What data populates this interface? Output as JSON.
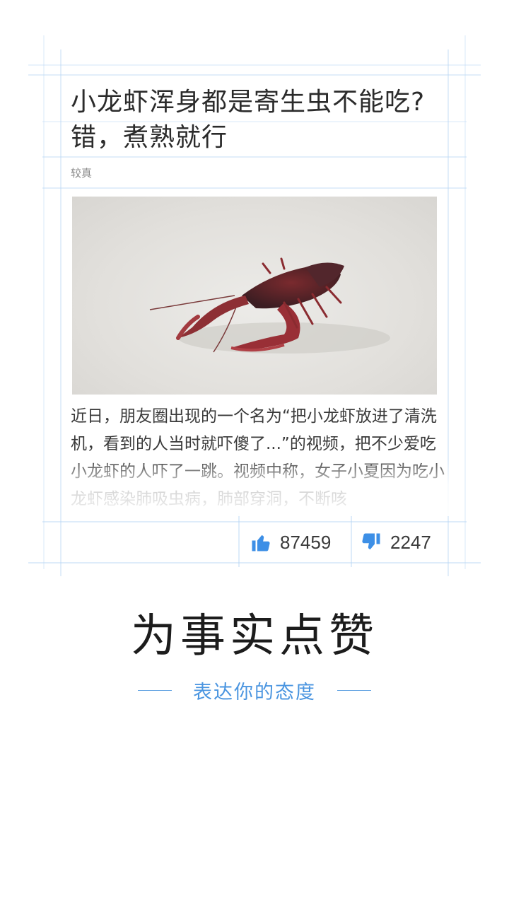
{
  "article": {
    "title": "小龙虾浑身都是寄生虫不能吃?错，煮熟就行",
    "source": "较真",
    "image_alt": "crayfish-photo",
    "body": "近日，朋友圈出现的一个名为“把小龙虾放进了清洗机，看到的人当时就吓傻了...”的视频，把不少爱吃小龙虾的人吓了一跳。视频中称，女子小夏因为吃小龙虾感染肺吸虫病，肺部穿洞，不断咳"
  },
  "actions": {
    "like_count": "87459",
    "dislike_count": "2247"
  },
  "promo": {
    "slogan": "为事实点赞",
    "tagline": "表达你的态度"
  },
  "colors": {
    "accent": "#3d8fe6",
    "guide": "#a9cdf3"
  }
}
